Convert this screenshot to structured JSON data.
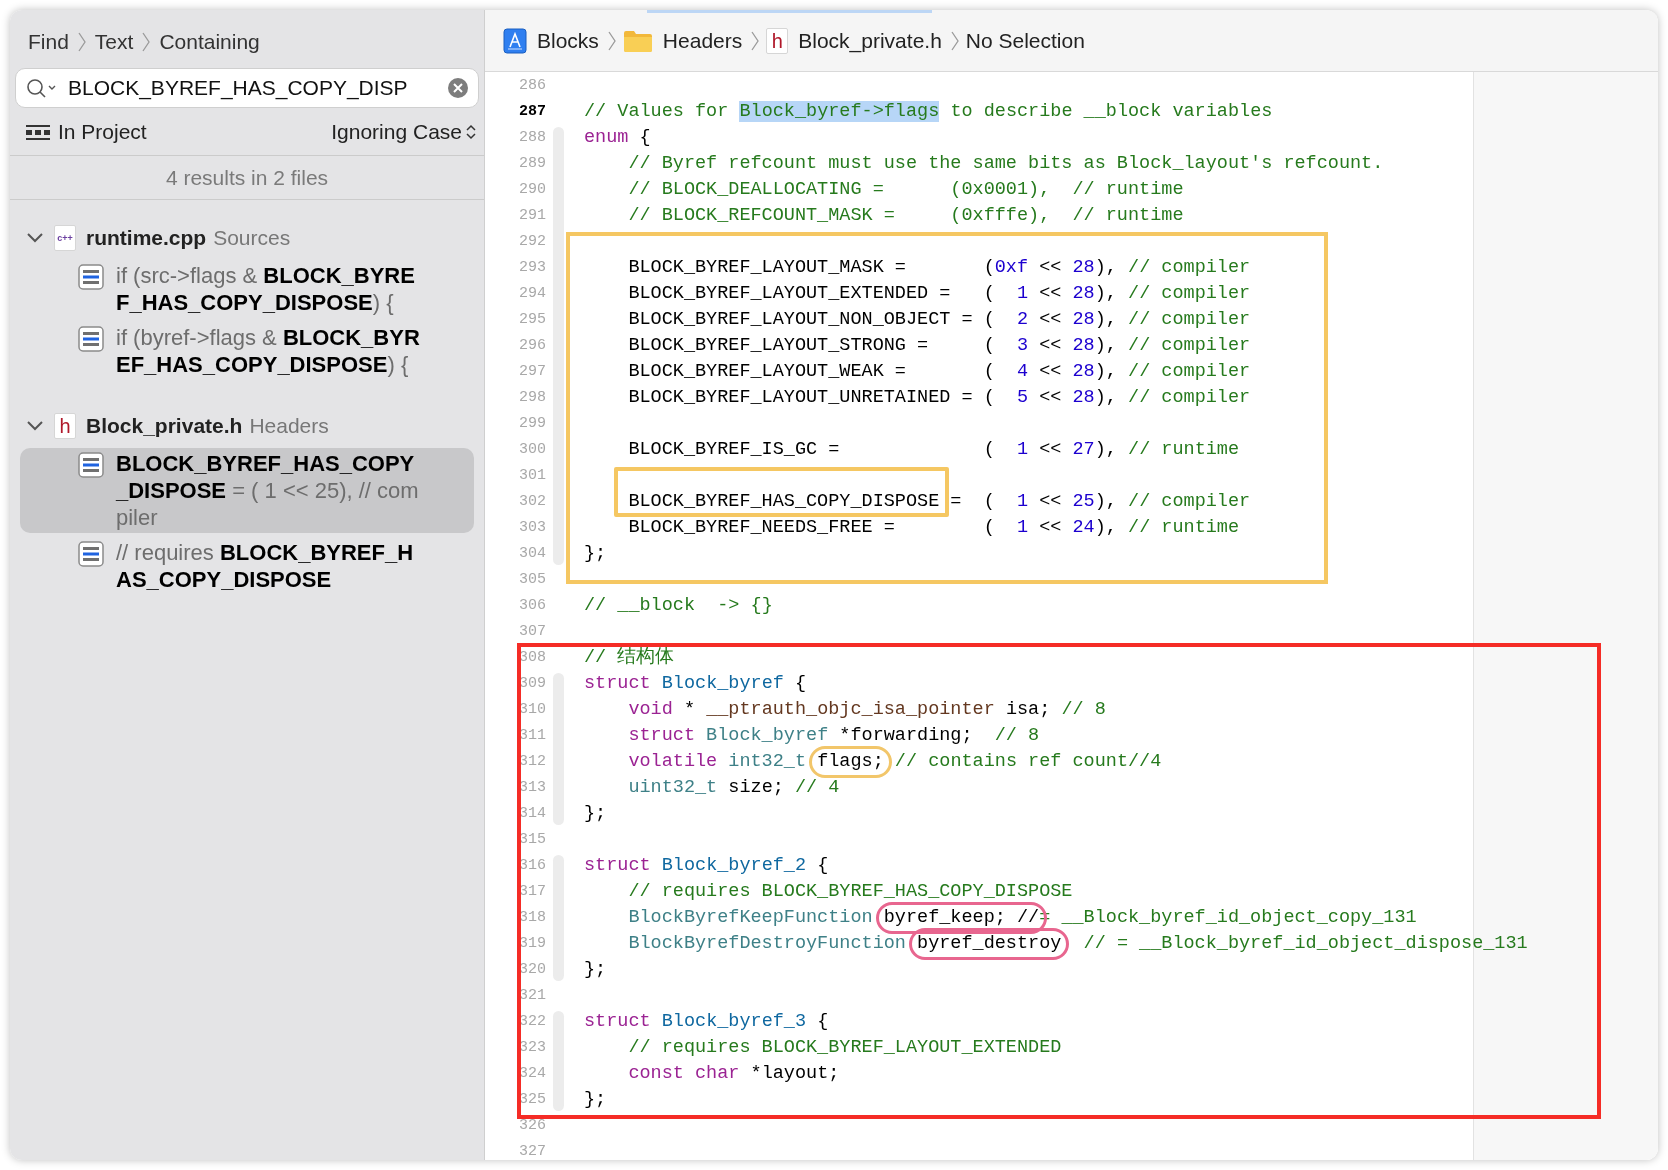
{
  "find": {
    "breadcrumb": [
      "Find",
      "Text",
      "Containing"
    ],
    "search": {
      "value": "BLOCK_BYREF_HAS_COPY_DISP"
    },
    "scope": "In Project",
    "matching": "Ignoring Case",
    "summary": "4 results in 2 files",
    "groups": [
      {
        "file": "runtime.cpp",
        "folder": "Sources",
        "badge": "c++",
        "kind": "cpp",
        "expanded": true,
        "results": [
          {
            "text": "if (src->flags & **BLOCK_BYREF_HAS_COPY_DISPOSE**) {",
            "selected": false
          },
          {
            "text": "if (byref->flags & **BLOCK_BYREF_HAS_COPY_DISPOSE**) {",
            "selected": false
          }
        ]
      },
      {
        "file": "Block_private.h",
        "folder": "Headers",
        "badge": "h",
        "kind": "header",
        "expanded": true,
        "results": [
          {
            "text": "**BLOCK_BYREF_HAS_COPY_DISPOSE** =  (  1 << 25), // compiler",
            "selected": true
          },
          {
            "text": "// requires **BLOCK_BYREF_HAS_COPY_DISPOSE**",
            "selected": false
          }
        ]
      }
    ]
  },
  "jump_bar": [
    {
      "kind": "project",
      "label": "Blocks"
    },
    {
      "kind": "folder",
      "label": "Headers"
    },
    {
      "kind": "header",
      "badge": "h",
      "label": "Block_private.h"
    },
    {
      "kind": "plain",
      "label": "No Selection"
    }
  ],
  "annotations": [
    {
      "kind": "frame",
      "color": "#f5c762"
    },
    {
      "kind": "frame",
      "color": "#f52c26"
    }
  ],
  "code": [
    {
      "number": "286",
      "current": false
    },
    {
      "number": "287",
      "current": true,
      "indented": false,
      "tokens": [
        {
          "kind": "comment",
          "text": "// Values for "
        },
        {
          "kind": "match",
          "text": "Block_byref->flags"
        },
        {
          "kind": "comment",
          "text": " to describe __block variables"
        }
      ]
    },
    {
      "number": "288",
      "current": false,
      "indented": false,
      "tokens": [
        {
          "kind": "keyword",
          "text": "enum"
        },
        {
          "kind": "plain",
          "text": " {"
        }
      ]
    },
    {
      "number": "289",
      "current": false,
      "indented": true,
      "tokens": [
        {
          "kind": "comment",
          "text": "// Byref refcount must use the same bits as Block_layout's refcount."
        }
      ]
    },
    {
      "number": "290",
      "current": false,
      "indented": true,
      "tokens": [
        {
          "kind": "comment",
          "text": "// BLOCK_DEALLOCATING =      (0x0001),  // runtime"
        }
      ]
    },
    {
      "number": "291",
      "current": false,
      "indented": true,
      "tokens": [
        {
          "kind": "comment",
          "text": "// BLOCK_REFCOUNT_MASK =     (0xfffe),  // runtime"
        }
      ]
    },
    {
      "number": "292",
      "current": false
    },
    {
      "number": "293",
      "current": false,
      "indented": true,
      "tokens": [
        {
          "kind": "plain",
          "text": "BLOCK_BYREF_LAYOUT_MASK =       ("
        },
        {
          "kind": "number",
          "text": "0xf"
        },
        {
          "kind": "plain",
          "text": " << "
        },
        {
          "kind": "number",
          "text": "28"
        },
        {
          "kind": "plain",
          "text": "), "
        },
        {
          "kind": "comment",
          "text": "// compiler"
        }
      ]
    },
    {
      "number": "294",
      "current": false,
      "indented": true,
      "tokens": [
        {
          "kind": "plain",
          "text": "BLOCK_BYREF_LAYOUT_EXTENDED =   (  "
        },
        {
          "kind": "number",
          "text": "1"
        },
        {
          "kind": "plain",
          "text": " << "
        },
        {
          "kind": "number",
          "text": "28"
        },
        {
          "kind": "plain",
          "text": "), "
        },
        {
          "kind": "comment",
          "text": "// compiler"
        }
      ]
    },
    {
      "number": "295",
      "current": false,
      "indented": true,
      "tokens": [
        {
          "kind": "plain",
          "text": "BLOCK_BYREF_LAYOUT_NON_OBJECT = (  "
        },
        {
          "kind": "number",
          "text": "2"
        },
        {
          "kind": "plain",
          "text": " << "
        },
        {
          "kind": "number",
          "text": "28"
        },
        {
          "kind": "plain",
          "text": "), "
        },
        {
          "kind": "comment",
          "text": "// compiler"
        }
      ]
    },
    {
      "number": "296",
      "current": false,
      "indented": true,
      "tokens": [
        {
          "kind": "plain",
          "text": "BLOCK_BYREF_LAYOUT_STRONG =     (  "
        },
        {
          "kind": "number",
          "text": "3"
        },
        {
          "kind": "plain",
          "text": " << "
        },
        {
          "kind": "number",
          "text": "28"
        },
        {
          "kind": "plain",
          "text": "), "
        },
        {
          "kind": "comment",
          "text": "// compiler"
        }
      ]
    },
    {
      "number": "297",
      "current": false,
      "indented": true,
      "tokens": [
        {
          "kind": "plain",
          "text": "BLOCK_BYREF_LAYOUT_WEAK =       (  "
        },
        {
          "kind": "number",
          "text": "4"
        },
        {
          "kind": "plain",
          "text": " << "
        },
        {
          "kind": "number",
          "text": "28"
        },
        {
          "kind": "plain",
          "text": "), "
        },
        {
          "kind": "comment",
          "text": "// compiler"
        }
      ]
    },
    {
      "number": "298",
      "current": false,
      "indented": true,
      "tokens": [
        {
          "kind": "plain",
          "text": "BLOCK_BYREF_LAYOUT_UNRETAINED = (  "
        },
        {
          "kind": "number",
          "text": "5"
        },
        {
          "kind": "plain",
          "text": " << "
        },
        {
          "kind": "number",
          "text": "28"
        },
        {
          "kind": "plain",
          "text": "), "
        },
        {
          "kind": "comment",
          "text": "// compiler"
        }
      ]
    },
    {
      "number": "299",
      "current": false
    },
    {
      "number": "300",
      "current": false,
      "indented": true,
      "tokens": [
        {
          "kind": "plain",
          "text": "BLOCK_BYREF_IS_GC =             (  "
        },
        {
          "kind": "number",
          "text": "1"
        },
        {
          "kind": "plain",
          "text": " << "
        },
        {
          "kind": "number",
          "text": "27"
        },
        {
          "kind": "plain",
          "text": "), "
        },
        {
          "kind": "comment",
          "text": "// runtime"
        }
      ]
    },
    {
      "number": "301",
      "current": false
    },
    {
      "number": "302",
      "current": false,
      "indented": true,
      "tokens": [
        {
          "kind": "plain",
          "text": "BLOCK_BYREF_HAS_COPY_DISPOSE",
          "marker": {
            "kind": "box",
            "color": "#f5c762"
          }
        },
        {
          "kind": "plain",
          "text": " =  (  "
        },
        {
          "kind": "number",
          "text": "1"
        },
        {
          "kind": "plain",
          "text": " << "
        },
        {
          "kind": "number",
          "text": "25"
        },
        {
          "kind": "plain",
          "text": "), "
        },
        {
          "kind": "comment",
          "text": "// compiler"
        }
      ]
    },
    {
      "number": "303",
      "current": false,
      "indented": true,
      "tokens": [
        {
          "kind": "plain",
          "text": "BLOCK_BYREF_NEEDS_FREE =        (  "
        },
        {
          "kind": "number",
          "text": "1"
        },
        {
          "kind": "plain",
          "text": " << "
        },
        {
          "kind": "number",
          "text": "24"
        },
        {
          "kind": "plain",
          "text": "), "
        },
        {
          "kind": "comment",
          "text": "// runtime"
        }
      ]
    },
    {
      "number": "304",
      "current": false,
      "indented": false,
      "tokens": [
        {
          "kind": "plain",
          "text": "};"
        }
      ]
    },
    {
      "number": "305",
      "current": false
    },
    {
      "number": "306",
      "current": false,
      "indented": false,
      "tokens": [
        {
          "kind": "comment",
          "text": "// __block  -> {}"
        }
      ]
    },
    {
      "number": "307",
      "current": false
    },
    {
      "number": "308",
      "current": false,
      "indented": false,
      "tokens": [
        {
          "kind": "comment",
          "text": "// 结构体"
        }
      ]
    },
    {
      "number": "309",
      "current": false,
      "indented": false,
      "tokens": [
        {
          "kind": "keyword",
          "text": "struct "
        },
        {
          "kind": "decl",
          "text": "Block_byref"
        },
        {
          "kind": "plain",
          "text": " {"
        }
      ]
    },
    {
      "number": "310",
      "current": false,
      "indented": true,
      "tokens": [
        {
          "kind": "keyword",
          "text": "void"
        },
        {
          "kind": "plain",
          "text": " * "
        },
        {
          "kind": "macro",
          "text": "__ptrauth_objc_isa_pointer"
        },
        {
          "kind": "plain",
          "text": " isa; "
        },
        {
          "kind": "comment",
          "text": "// 8"
        }
      ]
    },
    {
      "number": "311",
      "current": false,
      "indented": true,
      "tokens": [
        {
          "kind": "keyword",
          "text": "struct "
        },
        {
          "kind": "type",
          "text": "Block_byref"
        },
        {
          "kind": "plain",
          "text": " *forwarding;  "
        },
        {
          "kind": "comment",
          "text": "// 8"
        }
      ]
    },
    {
      "number": "312",
      "current": false,
      "indented": true,
      "tokens": [
        {
          "kind": "keyword",
          "text": "volatile "
        },
        {
          "kind": "type",
          "text": "int32_t "
        },
        {
          "kind": "plain",
          "text": "flags;",
          "marker": {
            "kind": "oval",
            "color": "#f2c66a"
          }
        },
        {
          "kind": "comment",
          "text": " // contains ref count//4"
        }
      ]
    },
    {
      "number": "313",
      "current": false,
      "indented": true,
      "tokens": [
        {
          "kind": "type",
          "text": "uint32_t"
        },
        {
          "kind": "plain",
          "text": " size; "
        },
        {
          "kind": "comment",
          "text": "// 4"
        }
      ]
    },
    {
      "number": "314",
      "current": false,
      "indented": false,
      "tokens": [
        {
          "kind": "plain",
          "text": "};"
        }
      ]
    },
    {
      "number": "315",
      "current": false
    },
    {
      "number": "316",
      "current": false,
      "indented": false,
      "tokens": [
        {
          "kind": "keyword",
          "text": "struct "
        },
        {
          "kind": "decl",
          "text": "Block_byref_2"
        },
        {
          "kind": "plain",
          "text": " {"
        }
      ]
    },
    {
      "number": "317",
      "current": false,
      "indented": true,
      "tokens": [
        {
          "kind": "comment",
          "text": "// requires BLOCK_BYREF_HAS_COPY_DISPOSE"
        }
      ]
    },
    {
      "number": "318",
      "current": false,
      "indented": true,
      "tokens": [
        {
          "kind": "type",
          "text": "BlockByrefKeepFunction "
        },
        {
          "kind": "plain",
          "text": "byref_keep; //",
          "marker": {
            "kind": "oval",
            "color": "#e8668f"
          }
        },
        {
          "kind": "comment",
          "text": "= __Block_byref_id_object_copy_131"
        }
      ]
    },
    {
      "number": "319",
      "current": false,
      "indented": true,
      "tokens": [
        {
          "kind": "type",
          "text": "BlockByrefDestroyFunction "
        },
        {
          "kind": "plain",
          "text": "byref_destroy",
          "marker": {
            "kind": "oval",
            "color": "#e8668f"
          }
        },
        {
          "kind": "comment",
          "text": "  // = __Block_byref_id_object_dispose_131"
        }
      ]
    },
    {
      "number": "320",
      "current": false,
      "indented": false,
      "tokens": [
        {
          "kind": "plain",
          "text": "};"
        }
      ]
    },
    {
      "number": "321",
      "current": false
    },
    {
      "number": "322",
      "current": false,
      "indented": false,
      "tokens": [
        {
          "kind": "keyword",
          "text": "struct "
        },
        {
          "kind": "decl",
          "text": "Block_byref_3"
        },
        {
          "kind": "plain",
          "text": " {"
        }
      ]
    },
    {
      "number": "323",
      "current": false,
      "indented": true,
      "tokens": [
        {
          "kind": "comment",
          "text": "// requires BLOCK_BYREF_LAYOUT_EXTENDED"
        }
      ]
    },
    {
      "number": "324",
      "current": false,
      "indented": true,
      "tokens": [
        {
          "kind": "keyword",
          "text": "const char"
        },
        {
          "kind": "plain",
          "text": " *layout;"
        }
      ]
    },
    {
      "number": "325",
      "current": false,
      "indented": false,
      "tokens": [
        {
          "kind": "plain",
          "text": "};"
        }
      ]
    },
    {
      "number": "326",
      "current": false
    },
    {
      "number": "327",
      "current": false
    }
  ]
}
